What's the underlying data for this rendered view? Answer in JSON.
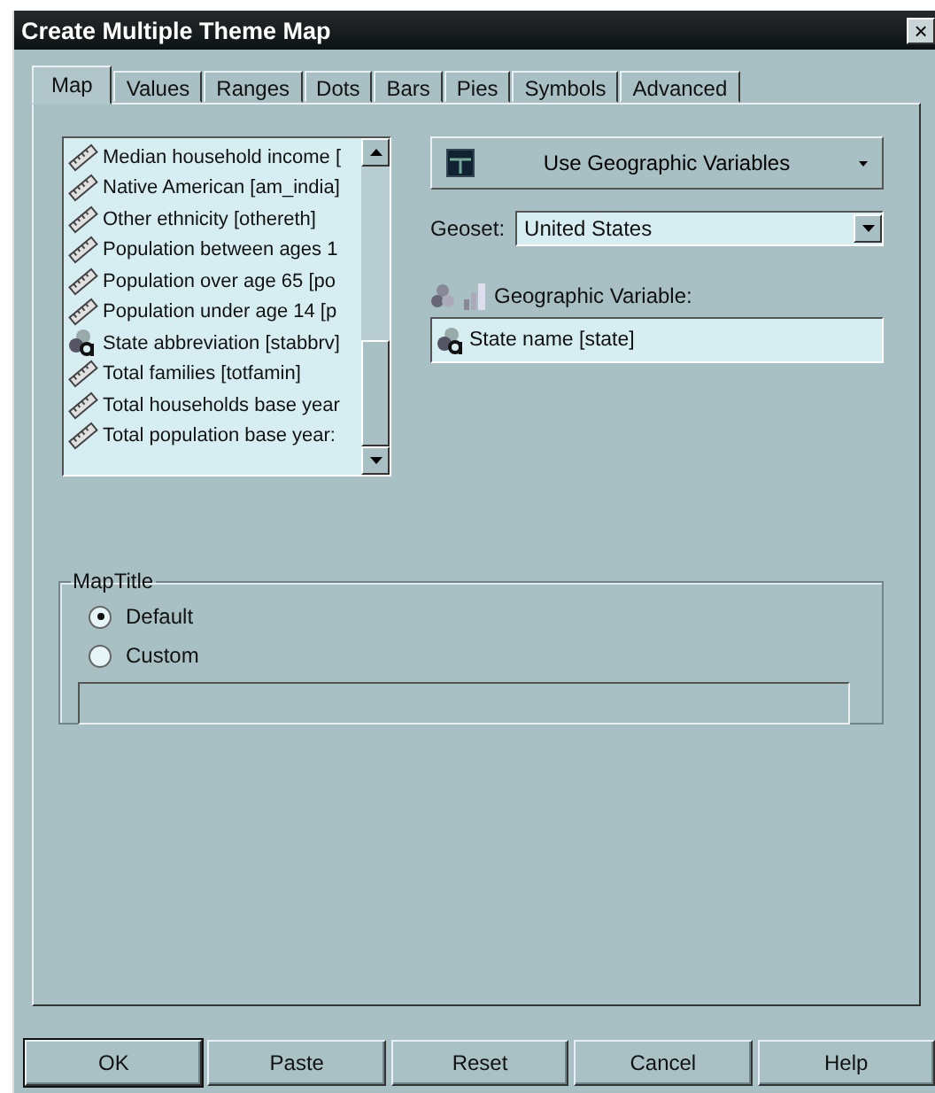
{
  "window": {
    "title": "Create Multiple Theme Map",
    "close": "×"
  },
  "tabs": [
    {
      "label": "Map",
      "selected": true
    },
    {
      "label": "Values",
      "selected": false
    },
    {
      "label": "Ranges",
      "selected": false
    },
    {
      "label": "Dots",
      "selected": false
    },
    {
      "label": "Bars",
      "selected": false
    },
    {
      "label": "Pies",
      "selected": false
    },
    {
      "label": "Symbols",
      "selected": false
    },
    {
      "label": "Advanced",
      "selected": false
    }
  ],
  "variable_list": [
    {
      "kind": "numeric",
      "label": "Median household income ["
    },
    {
      "kind": "numeric",
      "label": "Native American [am_india]"
    },
    {
      "kind": "numeric",
      "label": "Other ethnicity [othereth]"
    },
    {
      "kind": "numeric",
      "label": "Population between ages 1"
    },
    {
      "kind": "numeric",
      "label": "Population over age 65 [po"
    },
    {
      "kind": "numeric",
      "label": "Population under age 14 [p"
    },
    {
      "kind": "geographic",
      "label": "State abbreviation [stabbrv]"
    },
    {
      "kind": "numeric",
      "label": "Total families [totfamin]"
    },
    {
      "kind": "numeric",
      "label": "Total households base year"
    },
    {
      "kind": "numeric",
      "label": "Total population base year:"
    }
  ],
  "mode_dropdown": {
    "label": "Use Geographic Variables"
  },
  "geoset": {
    "label": "Geoset:",
    "value": "United States"
  },
  "geographic_variable": {
    "label": "Geographic Variable:",
    "value": "State name [state]"
  },
  "map_title": {
    "legend": "MapTitle",
    "options": [
      {
        "label": "Default",
        "selected": true
      },
      {
        "label": "Custom",
        "selected": false
      }
    ]
  },
  "buttons": [
    "OK",
    "Paste",
    "Reset",
    "Cancel",
    "Help"
  ]
}
